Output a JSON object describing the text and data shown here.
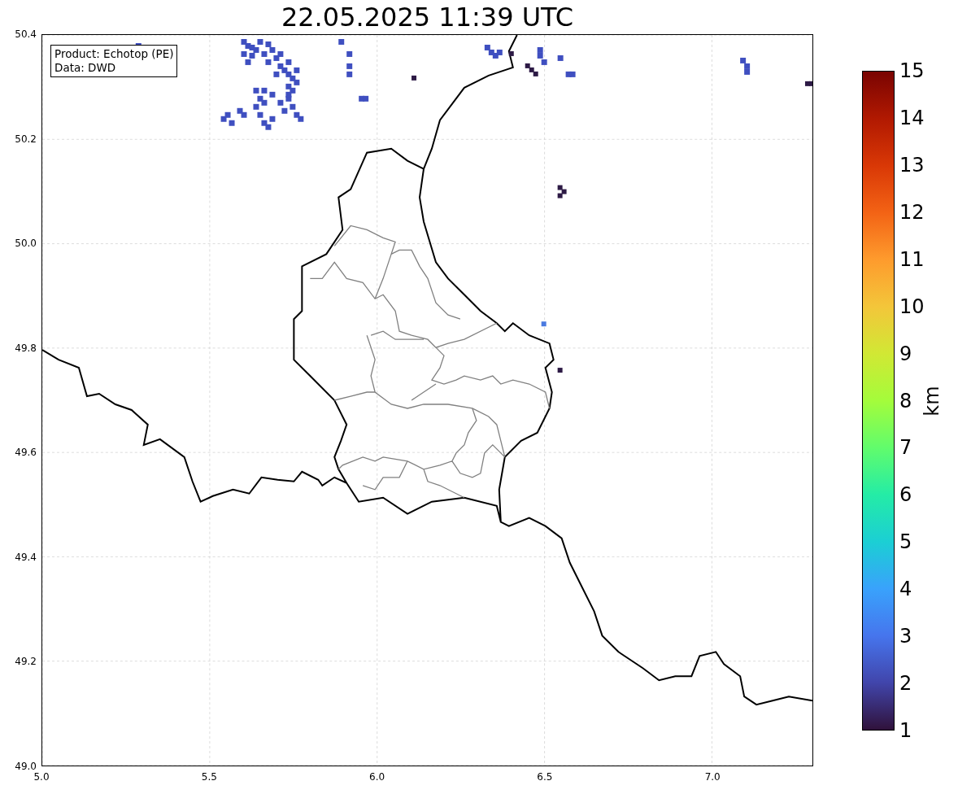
{
  "title": "22.05.2025 11:39 UTC",
  "map": {
    "info_box": [
      "Product: Echotop (PE)",
      "Data: DWD"
    ],
    "xticks": [
      "5.0",
      "5.5",
      "6.0",
      "6.5",
      "7.0"
    ],
    "yticks": [
      "50.4",
      "50.2",
      "50.0",
      "49.8",
      "49.6",
      "49.4",
      "49.2",
      "49.0"
    ]
  },
  "colorbar": {
    "label": "km",
    "ticks": [
      "15",
      "14",
      "13",
      "12",
      "11",
      "10",
      "9",
      "8",
      "7",
      "6",
      "5",
      "4",
      "3",
      "2",
      "1"
    ]
  }
}
